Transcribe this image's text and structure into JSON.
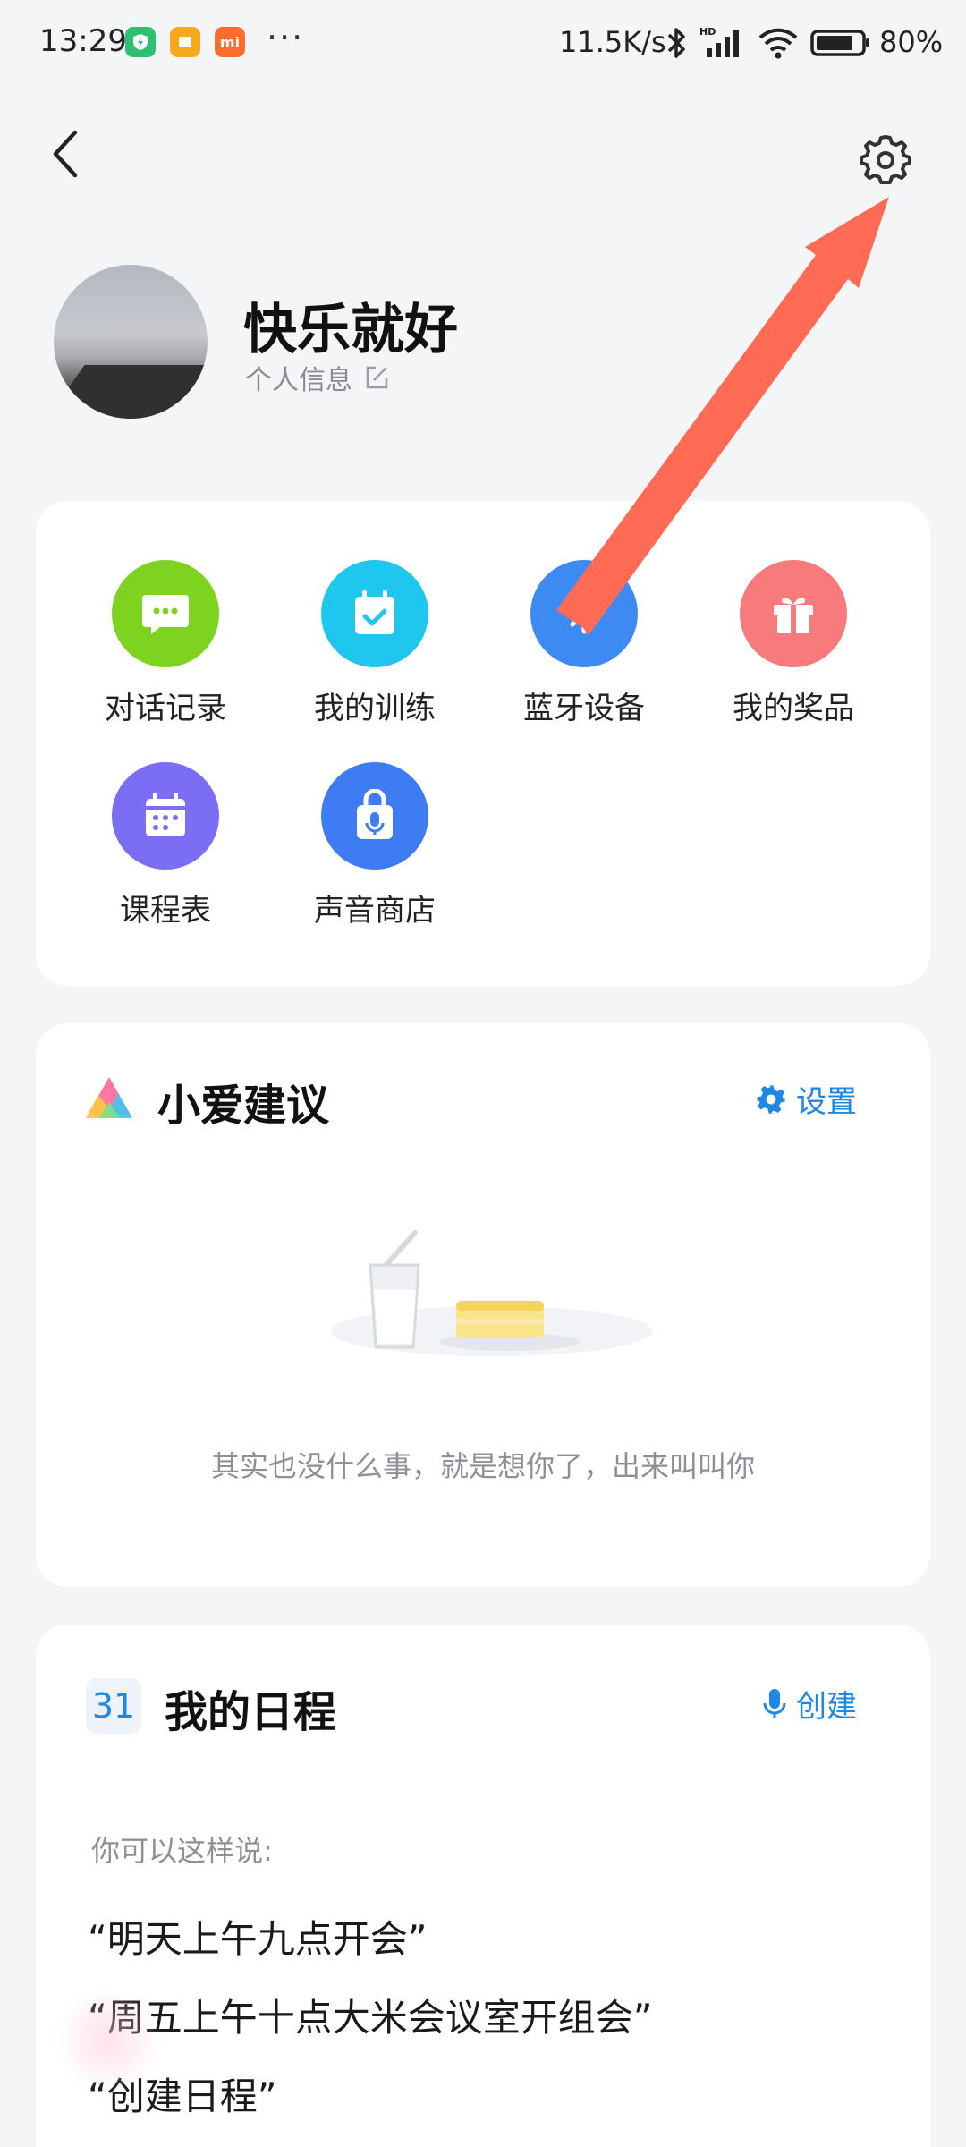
{
  "status_bar": {
    "time": "13:29",
    "more": "···",
    "network_speed": "11.5K/s",
    "hd_label": "HD",
    "battery_percent": "80%"
  },
  "header": {
    "back_icon": "chevron-left-icon",
    "settings_icon": "gear-icon"
  },
  "profile": {
    "name": "快乐就好",
    "info_link": "个人信息"
  },
  "quick_actions": [
    {
      "label": "对话记录",
      "icon": "chat-icon",
      "color": "#7ed321"
    },
    {
      "label": "我的训练",
      "icon": "calendar-check-icon",
      "color": "#1fc6ee"
    },
    {
      "label": "蓝牙设备",
      "icon": "bluetooth-icon",
      "color": "#3d8bf2"
    },
    {
      "label": "我的奖品",
      "icon": "gift-icon",
      "color": "#f77a7c"
    },
    {
      "label": "课程表",
      "icon": "calendar-grid-icon",
      "color": "#7b6ef4"
    },
    {
      "label": "声音商店",
      "icon": "shopping-bag-mic-icon",
      "color": "#3d7cf2"
    }
  ],
  "suggestion": {
    "title": "小爱建议",
    "settings_label": "设置",
    "empty_text": "其实也没什么事，就是想你了，出来叫叫你"
  },
  "schedule": {
    "day_badge": "31",
    "title": "我的日程",
    "create_label": "创建",
    "hint": "你可以这样说:",
    "examples": [
      "“明天上午九点开会”",
      "“周五上午十点大米会议室开组会”",
      "“创建日程”"
    ]
  },
  "colors": {
    "accent": "#1e88e5",
    "annotation_arrow": "#ff6b55"
  }
}
